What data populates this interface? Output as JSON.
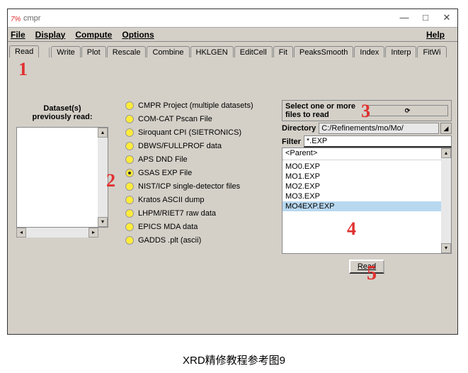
{
  "window": {
    "title": "cmpr"
  },
  "winbtns": {
    "min": "—",
    "max": "□",
    "close": "✕"
  },
  "menu": {
    "file": "File",
    "display": "Display",
    "compute": "Compute",
    "options": "Options",
    "help": "Help"
  },
  "tabs": [
    "Read",
    "Write",
    "Plot",
    "Rescale",
    "Combine",
    "HKLGEN",
    "EditCell",
    "Fit",
    "PeaksSmooth",
    "Index",
    "Interp",
    "FitWi"
  ],
  "left": {
    "label": "Dataset(s)\npreviously read:"
  },
  "formats": [
    "CMPR Project (multiple datasets)",
    "COM-CAT Pscan File",
    "Siroquant CPI (SIETRONICS)",
    "DBWS/FULLPROF data",
    "APS DND File",
    "GSAS EXP File",
    "NIST/ICP single-detector files",
    "Kratos ASCII dump",
    "LHPM/RIET7 raw data",
    "EPICS MDA data",
    "GADDS .plt (ascii)"
  ],
  "formats_selected_index": 5,
  "right": {
    "header": "Select one or more files to read",
    "dir_label": "Directory",
    "dir_value": "C:/Refinements/mo/Mo/",
    "filter_label": "Filter",
    "filter_value": "*.EXP",
    "parent": "<Parent>",
    "files": [
      "MO0.EXP",
      "MO1.EXP",
      "MO2.EXP",
      "MO3.EXP",
      "MO4EXP.EXP"
    ],
    "files_selected_index": 4,
    "read_btn": "Read"
  },
  "annotations": {
    "a1": "1",
    "a2": "2",
    "a3": "3",
    "a4": "4",
    "a5": "5"
  },
  "caption": "XRD精修教程参考图9"
}
